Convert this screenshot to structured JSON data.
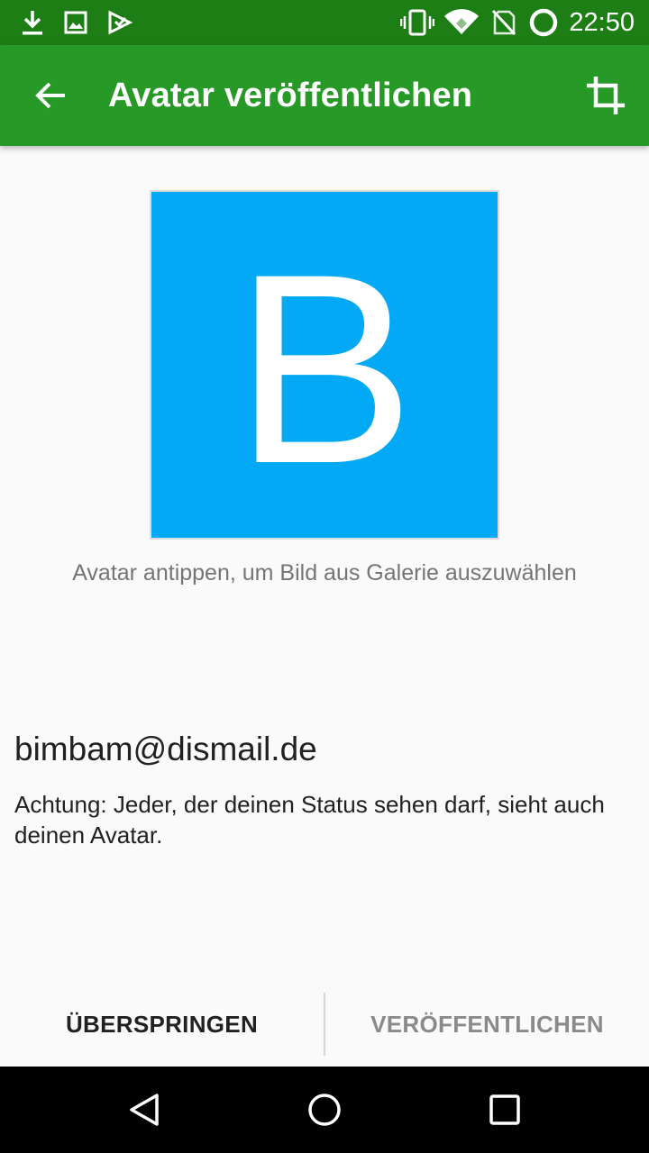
{
  "status_bar": {
    "time": "22:50",
    "left_icons": [
      "download-icon",
      "image-icon",
      "play-store-check-icon"
    ],
    "right_icons": [
      "vibrate-icon",
      "wifi-icon",
      "no-sim-icon",
      "battery-ring-icon"
    ]
  },
  "app_bar": {
    "title": "Avatar veröffentlichen",
    "back_icon": "arrow-back-icon",
    "crop_icon": "crop-icon",
    "color": "#269926"
  },
  "avatar": {
    "letter": "B",
    "color": "#03a9f4"
  },
  "hint": "Avatar antippen, um Bild aus Galerie auszuwählen",
  "account": {
    "jid": "bimbam@dismail.de",
    "warning": "Achtung: Jeder, der deinen Status sehen darf, sieht auch deinen Avatar."
  },
  "buttons": {
    "skip": "ÜBERSPRINGEN",
    "publish": "VERÖFFENTLICHEN"
  },
  "nav_bar": {
    "icons": [
      "back-triangle-icon",
      "home-circle-icon",
      "recents-square-icon"
    ]
  }
}
